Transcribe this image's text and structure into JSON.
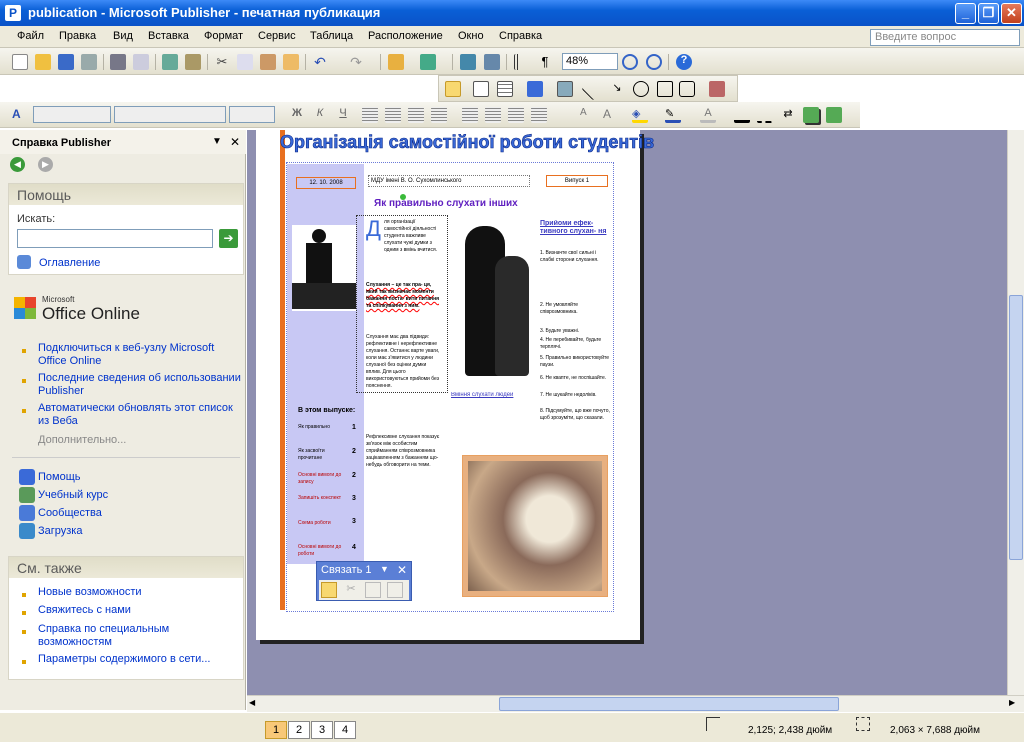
{
  "window": {
    "title": "publication - Microsoft Publisher - печатная публикация",
    "app_icon": "publisher-icon",
    "buttons": [
      "minimize",
      "maximize",
      "close"
    ]
  },
  "menu": {
    "items": [
      "Файл",
      "Правка",
      "Вид",
      "Вставка",
      "Формат",
      "Сервис",
      "Таблица",
      "Расположение",
      "Окно",
      "Справка"
    ],
    "ask_placeholder": "Введите вопрос"
  },
  "toolbar": {
    "zoom": "48%"
  },
  "taskpane": {
    "title": "Справка Publisher",
    "help_section": {
      "title": "Помощь",
      "search_label": "Искать:",
      "toc_link": "Оглавление"
    },
    "office_online": {
      "logo_small": "Microsoft",
      "logo_big": "Office Online",
      "links": [
        "Подключиться к веб-узлу Microsoft Office Online",
        "Последние сведения об использовании Publisher",
        "Автоматически обновлять этот список из Веба"
      ],
      "more": "Дополнительно..."
    },
    "resources": [
      "Помощь",
      "Учебный курс",
      "Сообщества",
      "Загрузка"
    ],
    "see_also": {
      "title": "См. также",
      "links": [
        "Новые возможности",
        "Свяжитесь с нами",
        "Справка по специальным возможностям",
        "Параметры содержимого в сети..."
      ]
    }
  },
  "publication": {
    "headline": "Організація самостійної роботи студентів",
    "date": "12. 10. 2008",
    "author": "МДУ імені В. О. Сухомлинського",
    "issue": "Випуск 1",
    "article_title": "Як правильно слухати інших",
    "dropcap": "Д",
    "para1": "ля організації самостійної діяльності студента важливе слухати чужі думки з одним з вмінь вчитися.",
    "para2": "Слухання – це так пра- ця, який так визначає моменти бажання поста- вити питання та спілкування з ним.",
    "para3": "Слухання має два підвиди: рефлективне і нерефлективне слухання. Останнє варте уваги, коли має з'явитися у людини слуханої без оцінки думки вплив. Для цього використовуються прийоми без пояснення.",
    "para4": "Рефлексивне слухання показує зв'язок між особистим сприйманням співрозмовника зацікавленням з бажанням що-небудь обговорити на теми.",
    "caption": "Вміння слухати людей",
    "sidebar_title": "Прийоми ефек- тивного слухан- ня",
    "sidebar_items": [
      "1. Визначте свої сильні і слабкі сторони слухання.",
      "2. Не умовляйте співрозмовника.",
      "3. Будьте уважні.",
      "4. Не перебивайте, будьте терплячі.",
      "5. Правильно використовуйте паузи.",
      "6. Не квапте, не поспішайте.",
      "7. Не шукайте недоліків.",
      "8. Підсумуйте, що вже почуто, щоб зрозуміти, що сказали."
    ],
    "toc_title": "В этом выпуске:",
    "toc_rows": [
      {
        "label": "Як правильно",
        "page": "1"
      },
      {
        "label": "Як засвоїти прочитане",
        "page": "2"
      },
      {
        "label": "Основні вимоги до запису",
        "page": "2"
      },
      {
        "label": "Запишіть конспект",
        "page": "3"
      },
      {
        "label": "Схема роботи",
        "page": "3"
      },
      {
        "label": "Основні вимоги до роботи",
        "page": "4"
      }
    ]
  },
  "connect_toolbar": {
    "title": "Связать 1"
  },
  "status": {
    "pages": [
      "1",
      "2",
      "3",
      "4"
    ],
    "active_page": "1",
    "position": "2,125; 2,438 дюйм",
    "size": "2,063 × 7,688 дюйм"
  }
}
